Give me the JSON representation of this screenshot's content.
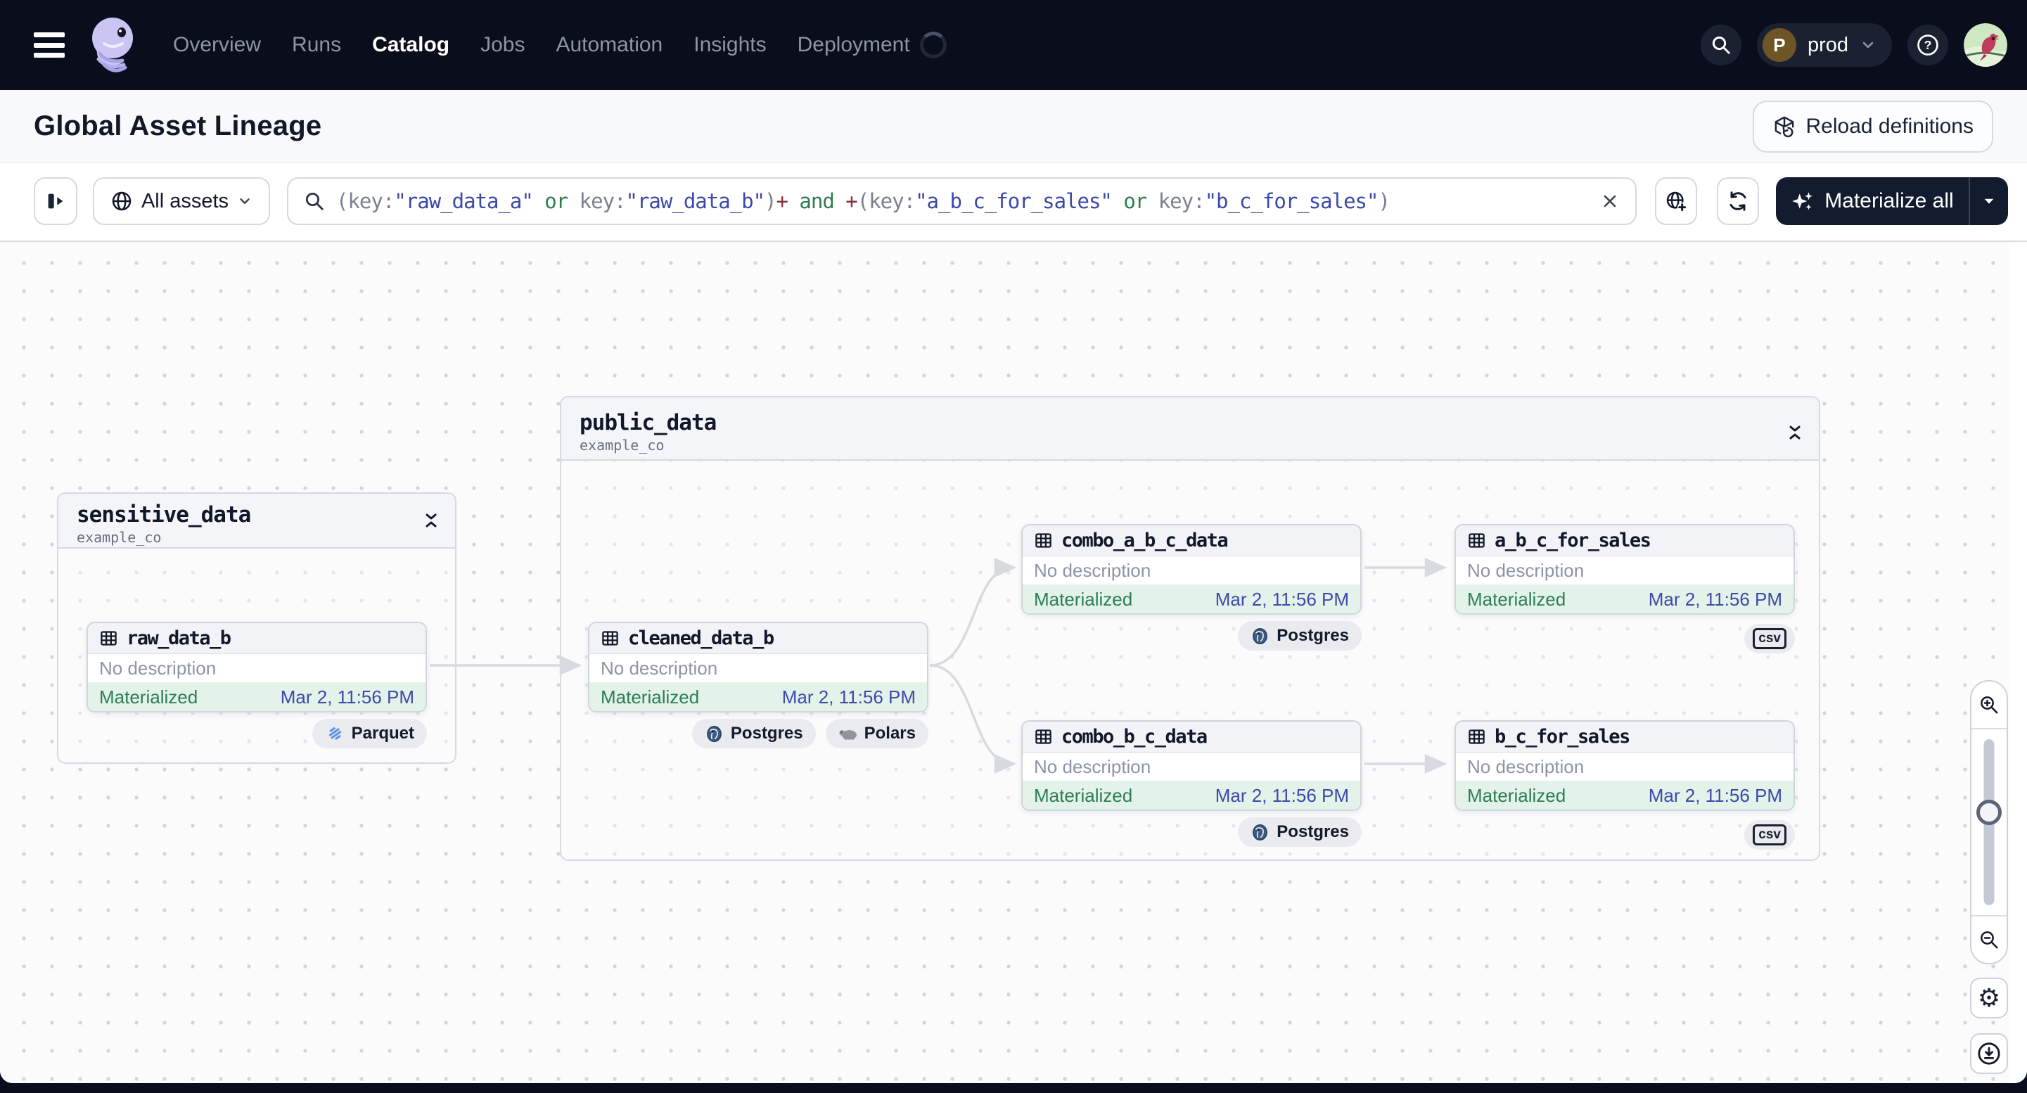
{
  "nav": {
    "items": [
      {
        "label": "Overview",
        "active": false
      },
      {
        "label": "Runs",
        "active": false
      },
      {
        "label": "Catalog",
        "active": true
      },
      {
        "label": "Jobs",
        "active": false
      },
      {
        "label": "Automation",
        "active": false
      },
      {
        "label": "Insights",
        "active": false
      },
      {
        "label": "Deployment",
        "active": false
      }
    ],
    "workspace": {
      "initial": "P",
      "name": "prod"
    }
  },
  "header": {
    "title": "Global Asset Lineage",
    "reload_button": "Reload definitions"
  },
  "toolbar": {
    "filter_scope": "All assets",
    "materialize_button": "Materialize all",
    "query_tokens": [
      {
        "t": "(",
        "c": "p"
      },
      {
        "t": "key:",
        "c": "p"
      },
      {
        "t": "\"raw_data_a\"",
        "c": "v"
      },
      {
        "t": " or ",
        "c": "o"
      },
      {
        "t": "key:",
        "c": "p"
      },
      {
        "t": "\"raw_data_b\"",
        "c": "v"
      },
      {
        "t": ")",
        "c": "p"
      },
      {
        "t": "+",
        "c": "plus"
      },
      {
        "t": " and ",
        "c": "o"
      },
      {
        "t": "+",
        "c": "plus"
      },
      {
        "t": "(",
        "c": "p"
      },
      {
        "t": "key:",
        "c": "p"
      },
      {
        "t": "\"a_b_c_for_sales\"",
        "c": "v"
      },
      {
        "t": " or ",
        "c": "o"
      },
      {
        "t": "key:",
        "c": "p"
      },
      {
        "t": "\"b_c_for_sales\"",
        "c": "v"
      },
      {
        "t": ")",
        "c": "p"
      }
    ]
  },
  "graph": {
    "groups": [
      {
        "name": "sensitive_data",
        "location": "example_co"
      },
      {
        "name": "public_data",
        "location": "example_co"
      }
    ],
    "nodes": [
      {
        "name": "raw_data_b",
        "description": "No description",
        "status": "Materialized",
        "timestamp": "Mar 2, 11:56 PM",
        "badges": [
          "Parquet"
        ]
      },
      {
        "name": "cleaned_data_b",
        "description": "No description",
        "status": "Materialized",
        "timestamp": "Mar 2, 11:56 PM",
        "badges": [
          "Postgres",
          "Polars"
        ]
      },
      {
        "name": "combo_a_b_c_data",
        "description": "No description",
        "status": "Materialized",
        "timestamp": "Mar 2, 11:56 PM",
        "badges": [
          "Postgres"
        ]
      },
      {
        "name": "a_b_c_for_sales",
        "description": "No description",
        "status": "Materialized",
        "timestamp": "Mar 2, 11:56 PM",
        "badges": [
          "csv"
        ]
      },
      {
        "name": "combo_b_c_data",
        "description": "No description",
        "status": "Materialized",
        "timestamp": "Mar 2, 11:56 PM",
        "badges": [
          "Postgres"
        ]
      },
      {
        "name": "b_c_for_sales",
        "description": "No description",
        "status": "Materialized",
        "timestamp": "Mar 2, 11:56 PM",
        "badges": [
          "csv"
        ]
      }
    ]
  },
  "icons": {
    "nav_search": "magnifier",
    "help": "question-mark-circle",
    "reload": "cube-with-reload-arrow",
    "scope": "globe",
    "materialize": "sparkles",
    "refresh": "circular-arrows",
    "collapse": "chevrons-inward",
    "asset": "table-grid",
    "zoom_in": "magnifier-plus",
    "zoom_out": "magnifier-minus",
    "settings": "gear",
    "download": "arrow-down-in-circle"
  },
  "colors": {
    "nav_bg": "#0a0d1b",
    "accent_dark": "#131b2e",
    "status_green": "#2d7d55",
    "status_green_bg": "#e3f3e9",
    "timestamp_blue": "#3e49ac",
    "query_value": "#3b49a8",
    "query_operator": "#2e7d4f",
    "query_plus": "#8a3033",
    "edge": "#d7dade"
  }
}
